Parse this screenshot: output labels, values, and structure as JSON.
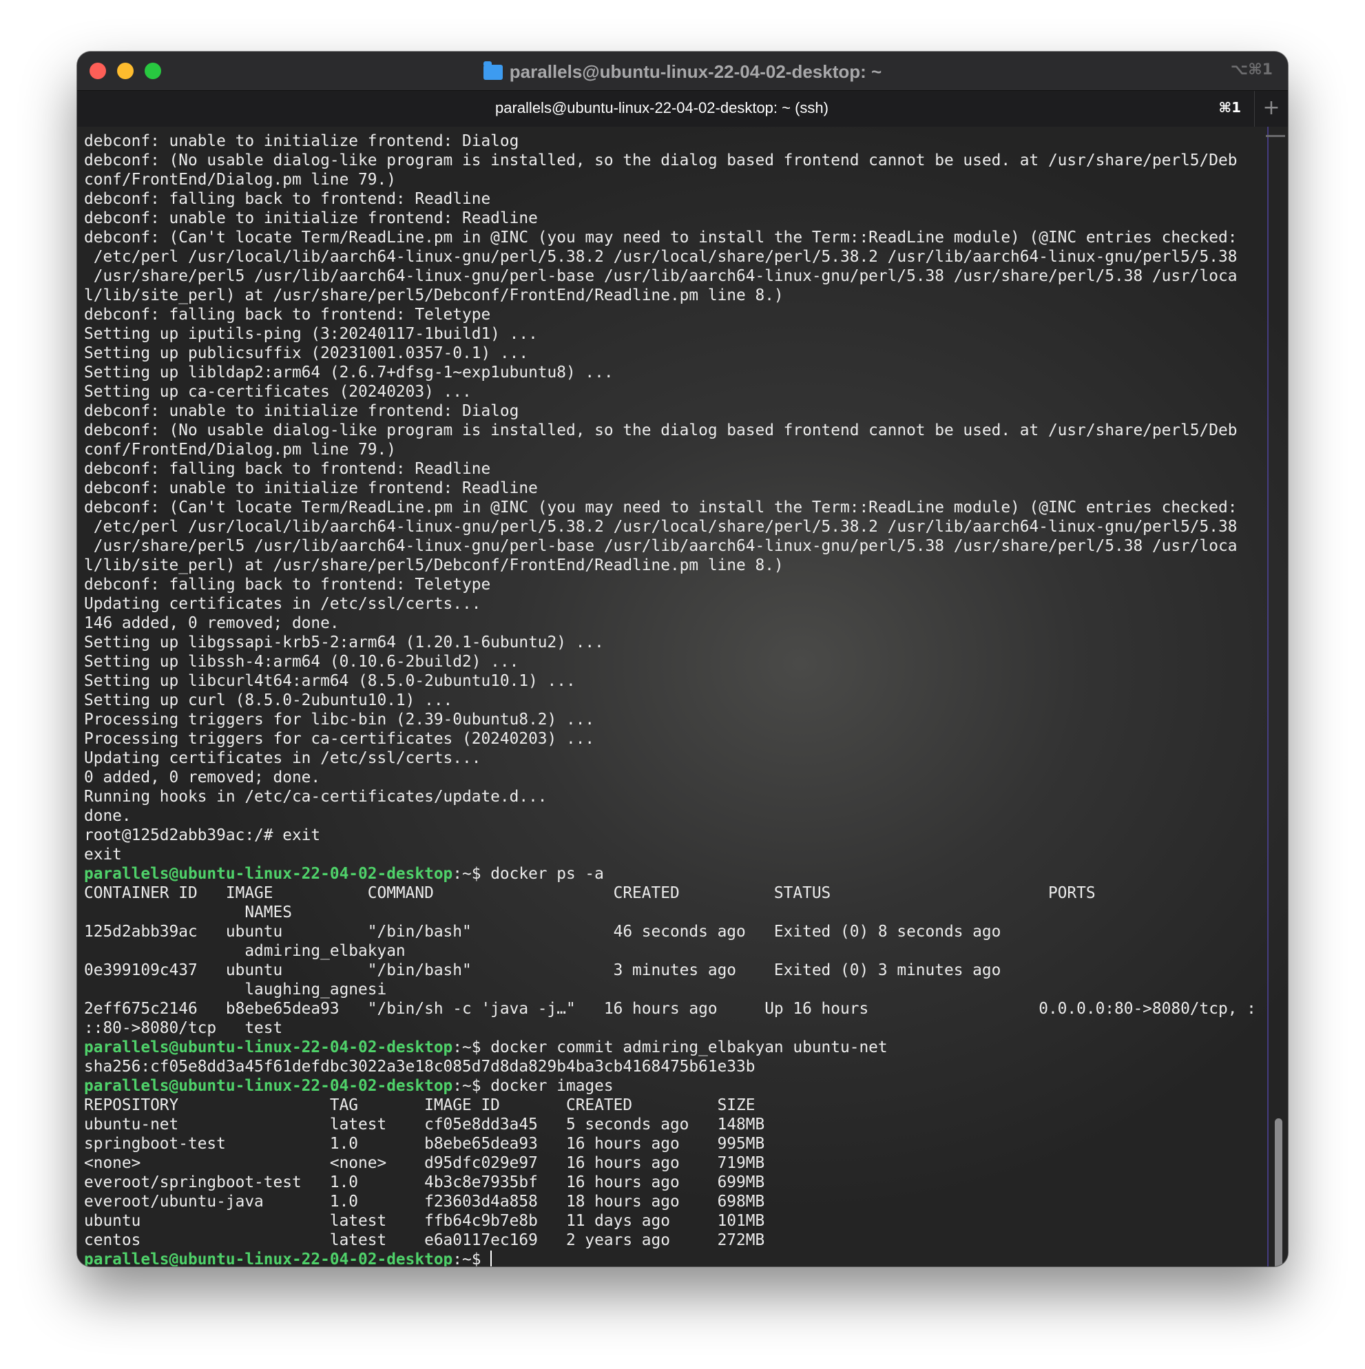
{
  "window": {
    "title": "parallels@ubuntu-linux-22-04-02-desktop: ~",
    "shortcut": "⌥⌘1"
  },
  "tab": {
    "label": "parallels@ubuntu-linux-22-04-02-desktop: ~ (ssh)",
    "shortcut": "⌘1",
    "new_tab_symbol": "+"
  },
  "terminal": {
    "prompt": "parallels@ubuntu-linux-22-04-02-desktop",
    "prompt_suffix": ":~$ ",
    "lines": [
      {
        "t": "debconf: unable to initialize frontend: Dialog"
      },
      {
        "t": "debconf: (No usable dialog-like program is installed, so the dialog based frontend cannot be used. at /usr/share/perl5/Deb"
      },
      {
        "t": "conf/FrontEnd/Dialog.pm line 79.)"
      },
      {
        "t": "debconf: falling back to frontend: Readline"
      },
      {
        "t": "debconf: unable to initialize frontend: Readline"
      },
      {
        "t": "debconf: (Can't locate Term/ReadLine.pm in @INC (you may need to install the Term::ReadLine module) (@INC entries checked:"
      },
      {
        "t": " /etc/perl /usr/local/lib/aarch64-linux-gnu/perl/5.38.2 /usr/local/share/perl/5.38.2 /usr/lib/aarch64-linux-gnu/perl5/5.38"
      },
      {
        "t": " /usr/share/perl5 /usr/lib/aarch64-linux-gnu/perl-base /usr/lib/aarch64-linux-gnu/perl/5.38 /usr/share/perl/5.38 /usr/loca"
      },
      {
        "t": "l/lib/site_perl) at /usr/share/perl5/Debconf/FrontEnd/Readline.pm line 8.)"
      },
      {
        "t": "debconf: falling back to frontend: Teletype"
      },
      {
        "t": "Setting up iputils-ping (3:20240117-1build1) ..."
      },
      {
        "t": "Setting up publicsuffix (20231001.0357-0.1) ..."
      },
      {
        "t": "Setting up libldap2:arm64 (2.6.7+dfsg-1~exp1ubuntu8) ..."
      },
      {
        "t": "Setting up ca-certificates (20240203) ..."
      },
      {
        "t": "debconf: unable to initialize frontend: Dialog"
      },
      {
        "t": "debconf: (No usable dialog-like program is installed, so the dialog based frontend cannot be used. at /usr/share/perl5/Deb"
      },
      {
        "t": "conf/FrontEnd/Dialog.pm line 79.)"
      },
      {
        "t": "debconf: falling back to frontend: Readline"
      },
      {
        "t": "debconf: unable to initialize frontend: Readline"
      },
      {
        "t": "debconf: (Can't locate Term/ReadLine.pm in @INC (you may need to install the Term::ReadLine module) (@INC entries checked:"
      },
      {
        "t": " /etc/perl /usr/local/lib/aarch64-linux-gnu/perl/5.38.2 /usr/local/share/perl/5.38.2 /usr/lib/aarch64-linux-gnu/perl5/5.38"
      },
      {
        "t": " /usr/share/perl5 /usr/lib/aarch64-linux-gnu/perl-base /usr/lib/aarch64-linux-gnu/perl/5.38 /usr/share/perl/5.38 /usr/loca"
      },
      {
        "t": "l/lib/site_perl) at /usr/share/perl5/Debconf/FrontEnd/Readline.pm line 8.)"
      },
      {
        "t": "debconf: falling back to frontend: Teletype"
      },
      {
        "t": "Updating certificates in /etc/ssl/certs..."
      },
      {
        "t": "146 added, 0 removed; done."
      },
      {
        "t": "Setting up libgssapi-krb5-2:arm64 (1.20.1-6ubuntu2) ..."
      },
      {
        "t": "Setting up libssh-4:arm64 (0.10.6-2build2) ..."
      },
      {
        "t": "Setting up libcurl4t64:arm64 (8.5.0-2ubuntu10.1) ..."
      },
      {
        "t": "Setting up curl (8.5.0-2ubuntu10.1) ..."
      },
      {
        "t": "Processing triggers for libc-bin (2.39-0ubuntu8.2) ..."
      },
      {
        "t": "Processing triggers for ca-certificates (20240203) ..."
      },
      {
        "t": "Updating certificates in /etc/ssl/certs..."
      },
      {
        "t": "0 added, 0 removed; done."
      },
      {
        "t": "Running hooks in /etc/ca-certificates/update.d..."
      },
      {
        "t": "done."
      },
      {
        "t": "root@125d2abb39ac:/# exit"
      },
      {
        "t": "exit"
      },
      {
        "p": true,
        "t": "docker ps -a"
      },
      {
        "t": "CONTAINER ID   IMAGE          COMMAND                   CREATED          STATUS                       PORTS"
      },
      {
        "t": "                 NAMES"
      },
      {
        "t": "125d2abb39ac   ubuntu         \"/bin/bash\"               46 seconds ago   Exited (0) 8 seconds ago"
      },
      {
        "t": "                 admiring_elbakyan"
      },
      {
        "t": "0e399109c437   ubuntu         \"/bin/bash\"               3 minutes ago    Exited (0) 3 minutes ago"
      },
      {
        "t": "                 laughing_agnesi"
      },
      {
        "t": "2eff675c2146   b8ebe65dea93   \"/bin/sh -c 'java -j…\"   16 hours ago     Up 16 hours                  0.0.0.0:80->8080/tcp, :"
      },
      {
        "t": "::80->8080/tcp   test"
      },
      {
        "p": true,
        "t": "docker commit admiring_elbakyan ubuntu-net"
      },
      {
        "t": "sha256:cf05e8dd3a45f61defdbc3022a3e18c085d7d8da829b4ba3cb4168475b61e33b"
      },
      {
        "p": true,
        "t": "docker images"
      },
      {
        "t": "REPOSITORY                TAG       IMAGE ID       CREATED         SIZE"
      },
      {
        "t": "ubuntu-net                latest    cf05e8dd3a45   5 seconds ago   148MB"
      },
      {
        "t": "springboot-test           1.0       b8ebe65dea93   16 hours ago    995MB"
      },
      {
        "t": "<none>                    <none>    d95dfc029e97   16 hours ago    719MB"
      },
      {
        "t": "everoot/springboot-test   1.0       4b3c8e7935bf   16 hours ago    699MB"
      },
      {
        "t": "everoot/ubuntu-java       1.0       f23603d4a858   18 hours ago    698MB"
      },
      {
        "t": "ubuntu                    latest    ffb64c9b7e8b   11 days ago     101MB"
      },
      {
        "t": "centos                    latest    e6a0117ec169   2 years ago     272MB"
      },
      {
        "p": true,
        "t": "",
        "cursor": true
      }
    ]
  },
  "colors": {
    "prompt": "#4fd26a",
    "text": "#ececec",
    "close": "#fe5f57",
    "minimize": "#febc2e",
    "zoom": "#28c840"
  }
}
